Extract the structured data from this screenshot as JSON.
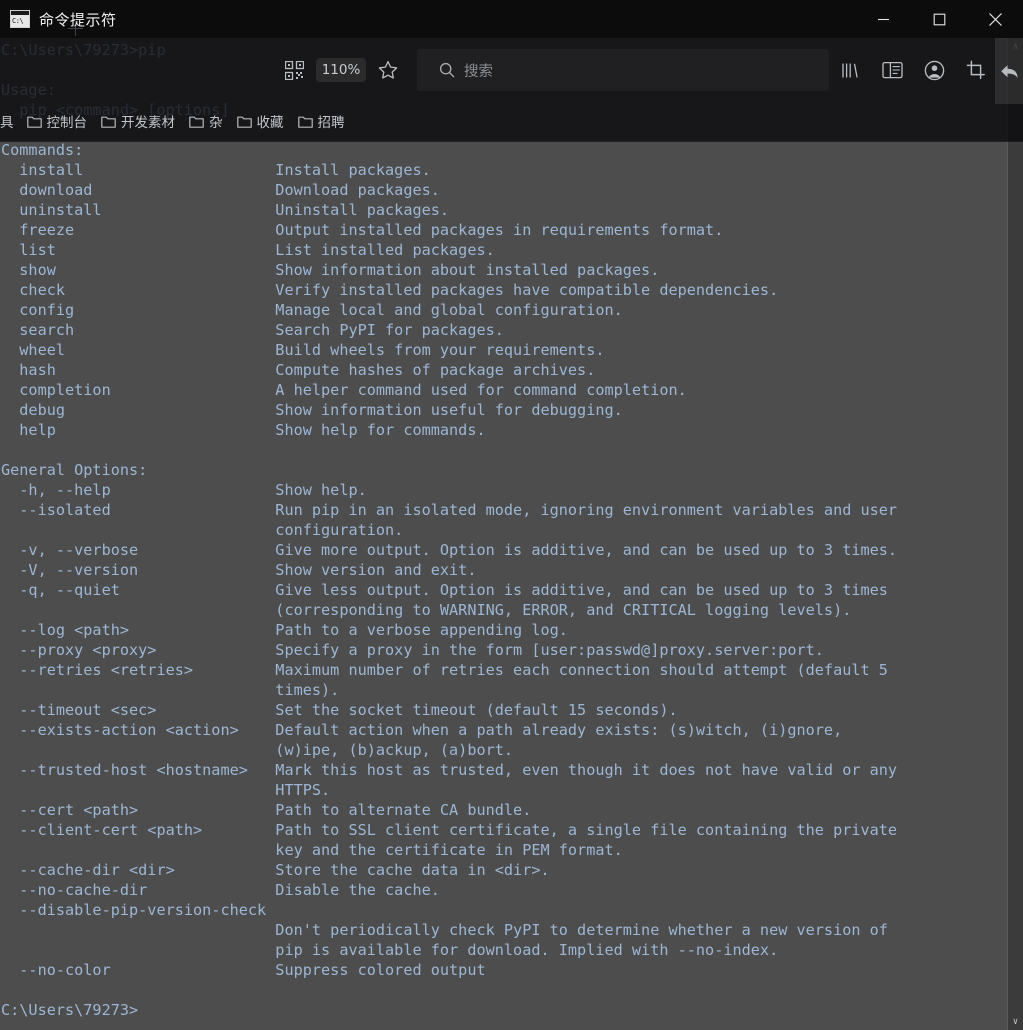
{
  "window": {
    "title": "命令提示符",
    "icon_label": "C:\\",
    "icon_name": "cmd-icon",
    "controls": {
      "minimize": "minimize",
      "maximize": "maximize",
      "close": "close"
    }
  },
  "browser_overlay": {
    "zoom_level": "110%",
    "search": {
      "placeholder": "搜索",
      "value": ""
    },
    "icons": {
      "qr": "qr-code-icon",
      "bookmark_star": "star-icon",
      "search": "search-icon",
      "library": "library-icon",
      "reader": "sidebar-icon",
      "account": "account-icon",
      "screenshot": "crop-icon",
      "back": "back-arrow-icon"
    },
    "bookmarks": {
      "clipped_label": "具",
      "folders": [
        {
          "label": "控制台"
        },
        {
          "label": "开发素材"
        },
        {
          "label": "杂"
        },
        {
          "label": "收藏"
        },
        {
          "label": "招聘"
        }
      ]
    }
  },
  "terminal": {
    "prompt_top": "C:\\Users\\79273>pip",
    "prompt_bottom": "C:\\Users\\79273>",
    "fg_color": "#9cb6d4",
    "bg_color": "#4d4d4d",
    "lines": [
      "C:\\Users\\79273>pip",
      "",
      "Usage:",
      "  pip <command> [options]",
      "",
      "Commands:",
      "  install                     Install packages.",
      "  download                    Download packages.",
      "  uninstall                   Uninstall packages.",
      "  freeze                      Output installed packages in requirements format.",
      "  list                        List installed packages.",
      "  show                        Show information about installed packages.",
      "  check                       Verify installed packages have compatible dependencies.",
      "  config                      Manage local and global configuration.",
      "  search                      Search PyPI for packages.",
      "  wheel                       Build wheels from your requirements.",
      "  hash                        Compute hashes of package archives.",
      "  completion                  A helper command used for command completion.",
      "  debug                       Show information useful for debugging.",
      "  help                        Show help for commands.",
      "",
      "General Options:",
      "  -h, --help                  Show help.",
      "  --isolated                  Run pip in an isolated mode, ignoring environment variables and user",
      "                              configuration.",
      "  -v, --verbose               Give more output. Option is additive, and can be used up to 3 times.",
      "  -V, --version               Show version and exit.",
      "  -q, --quiet                 Give less output. Option is additive, and can be used up to 3 times",
      "                              (corresponding to WARNING, ERROR, and CRITICAL logging levels).",
      "  --log <path>                Path to a verbose appending log.",
      "  --proxy <proxy>             Specify a proxy in the form [user:passwd@]proxy.server:port.",
      "  --retries <retries>         Maximum number of retries each connection should attempt (default 5",
      "                              times).",
      "  --timeout <sec>             Set the socket timeout (default 15 seconds).",
      "  --exists-action <action>    Default action when a path already exists: (s)witch, (i)gnore,",
      "                              (w)ipe, (b)ackup, (a)bort.",
      "  --trusted-host <hostname>   Mark this host as trusted, even though it does not have valid or any",
      "                              HTTPS.",
      "  --cert <path>               Path to alternate CA bundle.",
      "  --client-cert <path>        Path to SSL client certificate, a single file containing the private",
      "                              key and the certificate in PEM format.",
      "  --cache-dir <dir>           Store the cache data in <dir>.",
      "  --no-cache-dir              Disable the cache.",
      "  --disable-pip-version-check",
      "                              Don't periodically check PyPI to determine whether a new version of",
      "                              pip is available for download. Implied with --no-index.",
      "  --no-color                  Suppress colored output",
      "",
      "C:\\Users\\79273>"
    ]
  },
  "scrollbar": {
    "up_arrow": "∧",
    "down_arrow": "∨"
  }
}
